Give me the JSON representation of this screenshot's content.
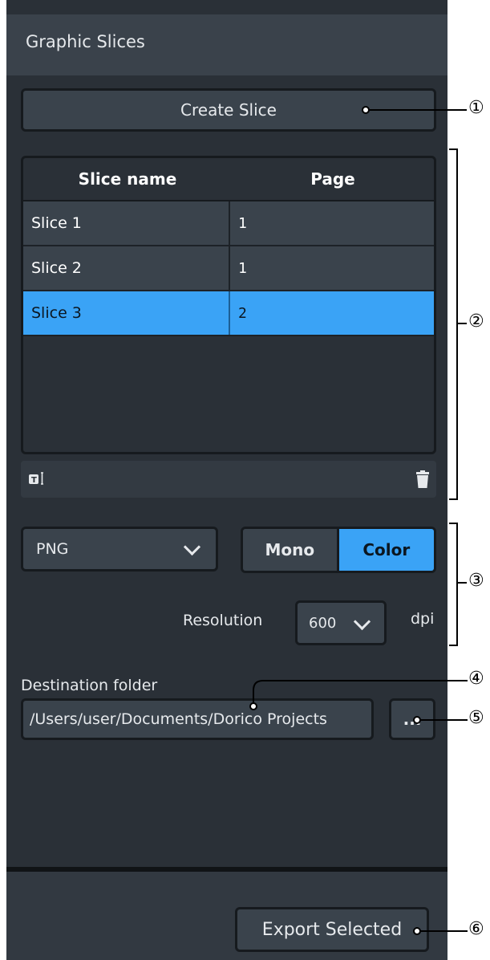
{
  "panel": {
    "title": "Graphic Slices"
  },
  "create_button": {
    "label": "Create Slice"
  },
  "table": {
    "columns": [
      "Slice name",
      "Page"
    ],
    "rows": [
      {
        "name": "Slice 1",
        "page": "1",
        "selected": false
      },
      {
        "name": "Slice 2",
        "page": "1",
        "selected": false
      },
      {
        "name": "Slice 3",
        "page": "2",
        "selected": true
      }
    ]
  },
  "format": {
    "value": "PNG"
  },
  "color_mode": {
    "options": [
      "Mono",
      "Color"
    ],
    "selected": "Color"
  },
  "resolution": {
    "label": "Resolution",
    "value": "600",
    "unit": "dpi"
  },
  "destination": {
    "label": "Destination folder",
    "path": "/Users/user/Documents/Dorico Projects",
    "browse_label": "..."
  },
  "export_button": {
    "label": "Export Selected"
  },
  "callouts": [
    "①",
    "②",
    "③",
    "④",
    "⑤",
    "⑥"
  ],
  "colors": {
    "panel_bg": "#2a3037",
    "accent": "#3aa3f6",
    "control_bg": "#3a434c"
  },
  "icons": {
    "title_icon": "text-slice-icon",
    "delete_icon": "trash-icon"
  }
}
